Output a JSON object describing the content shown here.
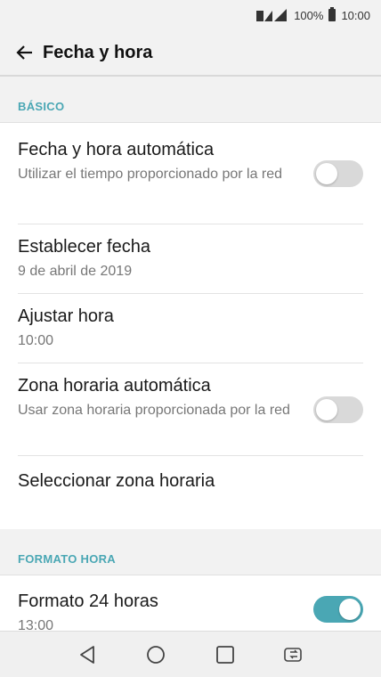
{
  "status_bar": {
    "battery": "100%",
    "time": "10:00"
  },
  "app_bar": {
    "title": "Fecha y hora"
  },
  "sections": [
    {
      "header": "BÁSICO",
      "items": [
        {
          "primary": "Fecha y hora automática",
          "secondary": "Utilizar el tiempo proporcionado por la red",
          "toggle": "off"
        },
        {
          "primary": "Establecer fecha",
          "secondary": "9 de abril de 2019"
        },
        {
          "primary": "Ajustar hora",
          "secondary": "10:00"
        },
        {
          "primary": "Zona horaria automática",
          "secondary": "Usar zona horaria proporcionada por la red",
          "toggle": "off"
        },
        {
          "primary": "Seleccionar zona horaria"
        }
      ]
    },
    {
      "header": "FORMATO HORA",
      "items": [
        {
          "primary": "Formato 24 horas",
          "secondary": "13:00",
          "toggle": "on"
        }
      ]
    }
  ],
  "colors": {
    "accent": "#4aa7b4",
    "toggle_off": "#d9d9d9"
  },
  "nav_bar": {
    "icons": [
      "back-triangle-icon",
      "home-circle-icon",
      "recents-square-icon",
      "dual-window-icon"
    ]
  }
}
